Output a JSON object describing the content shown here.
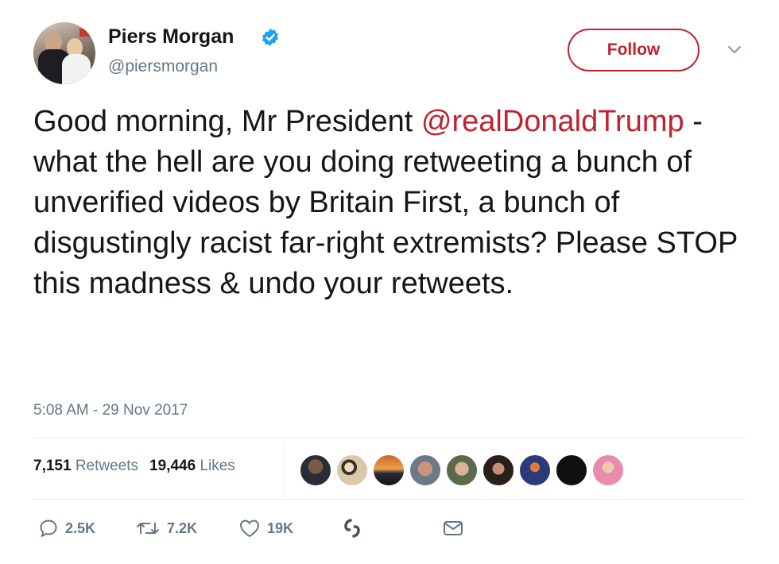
{
  "tweet": {
    "author": {
      "display_name": "Piers Morgan",
      "handle": "@piersmorgan",
      "verified": true
    },
    "follow_label": "Follow",
    "text": {
      "part1": "Good morning, Mr President ",
      "mention": "@realDonaldTrump",
      "part2": " - what the hell are you doing retweeting a bunch of unverified videos by Britain First, a bunch of disgustingly racist far-right extremists? Please STOP this madness & undo your retweets."
    },
    "timestamp": "5:08 AM - 29 Nov 2017",
    "stats": {
      "retweets_count": "7,151",
      "retweets_label": "Retweets",
      "likes_count": "19,446",
      "likes_label": "Likes"
    },
    "actions": {
      "replies": "2.5K",
      "retweets": "7.2K",
      "likes": "19K"
    }
  },
  "colors": {
    "accent": "#c0222e",
    "secondary_text": "#657786",
    "verified_blue": "#1da1f2"
  },
  "icons": [
    "verified-badge-icon",
    "chevron-down-icon",
    "reply-icon",
    "retweet-icon",
    "like-icon",
    "moments-icon",
    "direct-message-icon"
  ]
}
